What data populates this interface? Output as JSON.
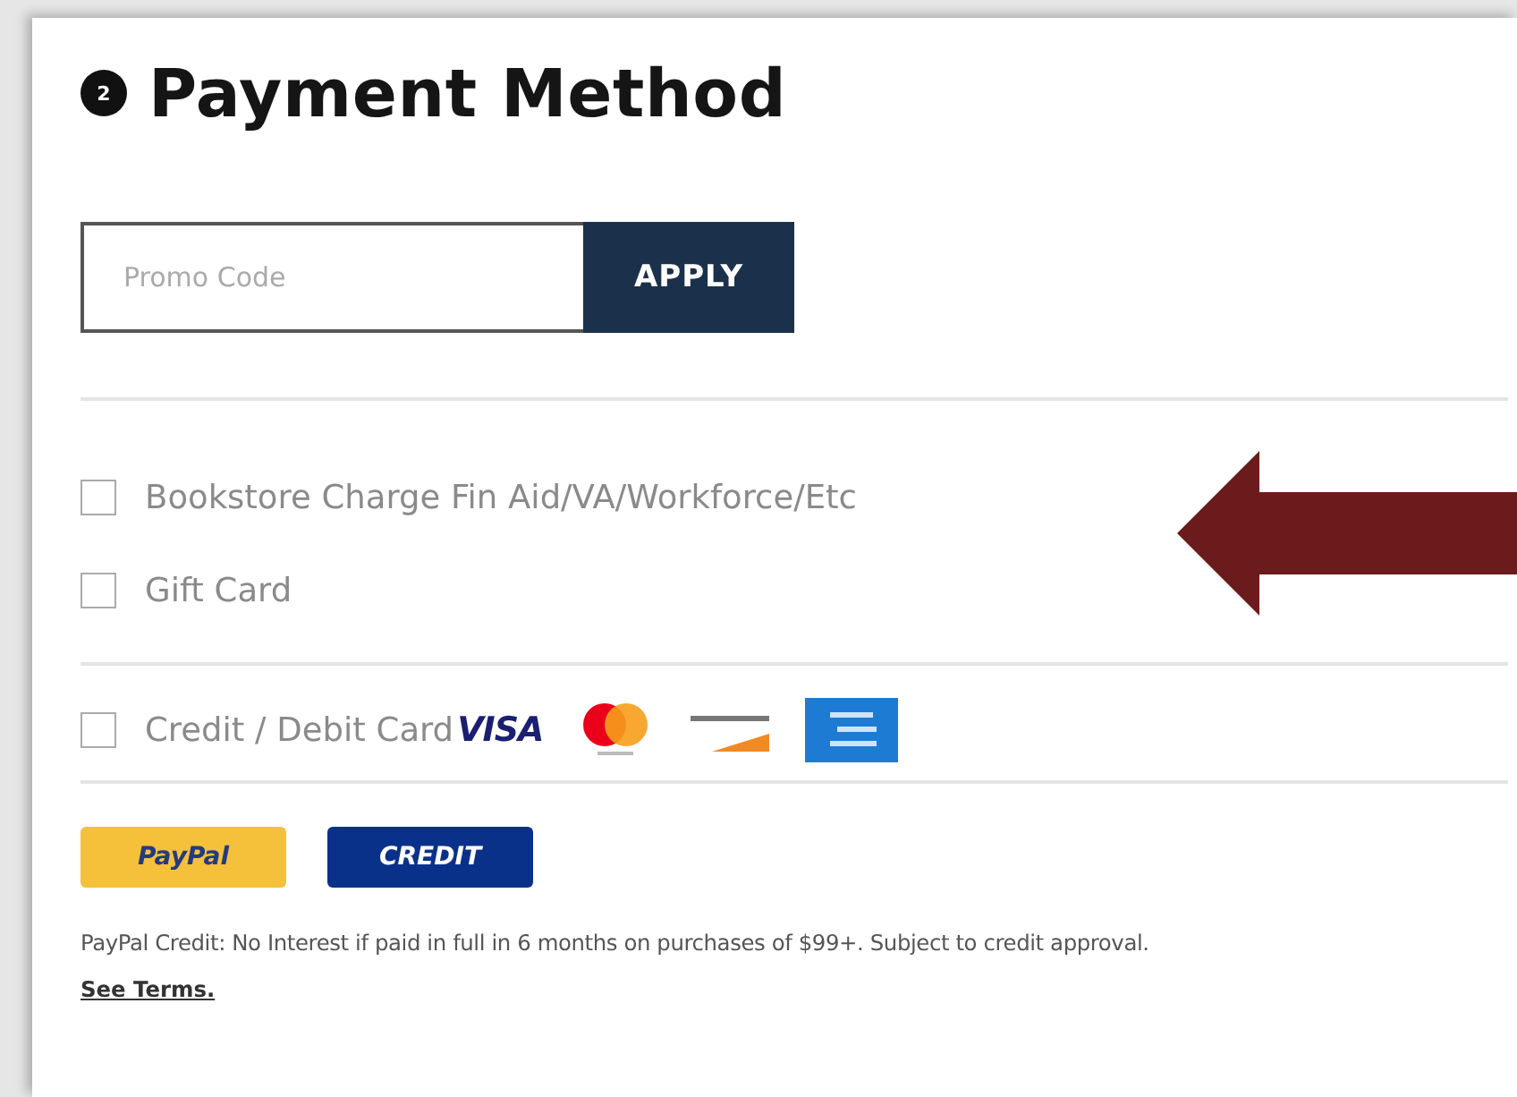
{
  "step": {
    "number": "2",
    "title": "Payment Method"
  },
  "promo": {
    "placeholder": "Promo Code",
    "button": "APPLY"
  },
  "option_groups": [
    {
      "options": [
        {
          "label": "Bookstore Charge Fin Aid/VA/Workforce/Etc",
          "checked": false
        },
        {
          "label": "Gift Card",
          "checked": false
        }
      ]
    },
    {
      "options": [
        {
          "label": "Credit / Debit Card",
          "checked": false,
          "card_logos": [
            {
              "kind": "visa",
              "label": "VISA"
            },
            {
              "kind": "mastercard"
            },
            {
              "kind": "discover"
            },
            {
              "kind": "amex"
            }
          ]
        }
      ]
    }
  ],
  "wallet_buttons": [
    {
      "kind": "paypal",
      "label": "PayPal"
    },
    {
      "kind": "credit",
      "label": "CREDIT"
    }
  ],
  "note": {
    "text": "PayPal Credit: No Interest if paid in full in 6 months on purchases of $99+. Subject to credit approval.",
    "link": "See Terms."
  },
  "annotation": {
    "kind": "arrow-left"
  }
}
